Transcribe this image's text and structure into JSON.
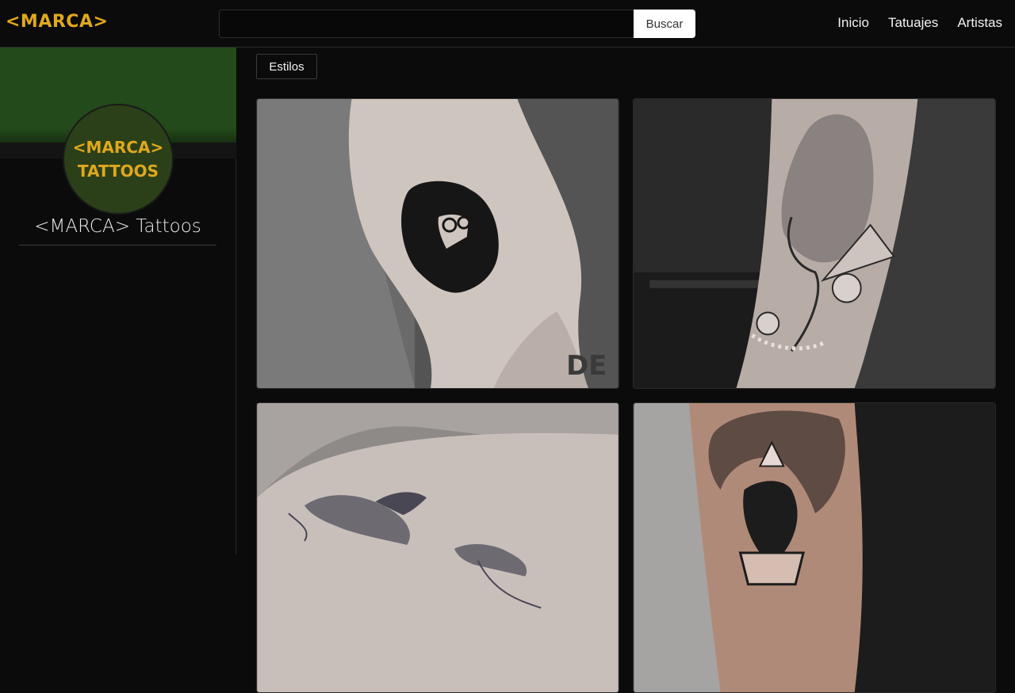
{
  "navbar": {
    "brand": "<MARCA>",
    "search": {
      "value": "",
      "placeholder": ""
    },
    "search_button": "Buscar",
    "links": [
      "Inicio",
      "Tatuajes",
      "Artistas"
    ]
  },
  "sidebar": {
    "logo_lines": [
      "<MARCA>",
      "TATTOOS"
    ],
    "name": "<MARCA> Tattoos"
  },
  "main": {
    "filter_button": "Estilos",
    "gallery": [
      {
        "subject": "silhouette-portrait-tattoo",
        "watermark": "DE"
      },
      {
        "subject": "neo-traditional-woman-tattoo"
      },
      {
        "subject": "koi-fish-tattoo"
      },
      {
        "subject": "ram-skull-tattoo"
      }
    ]
  },
  "colors": {
    "brand": "#e0a81c",
    "background": "#0b0b0b",
    "sidebar_banner": "#234a1a",
    "logo_circle": "#2b4019"
  }
}
